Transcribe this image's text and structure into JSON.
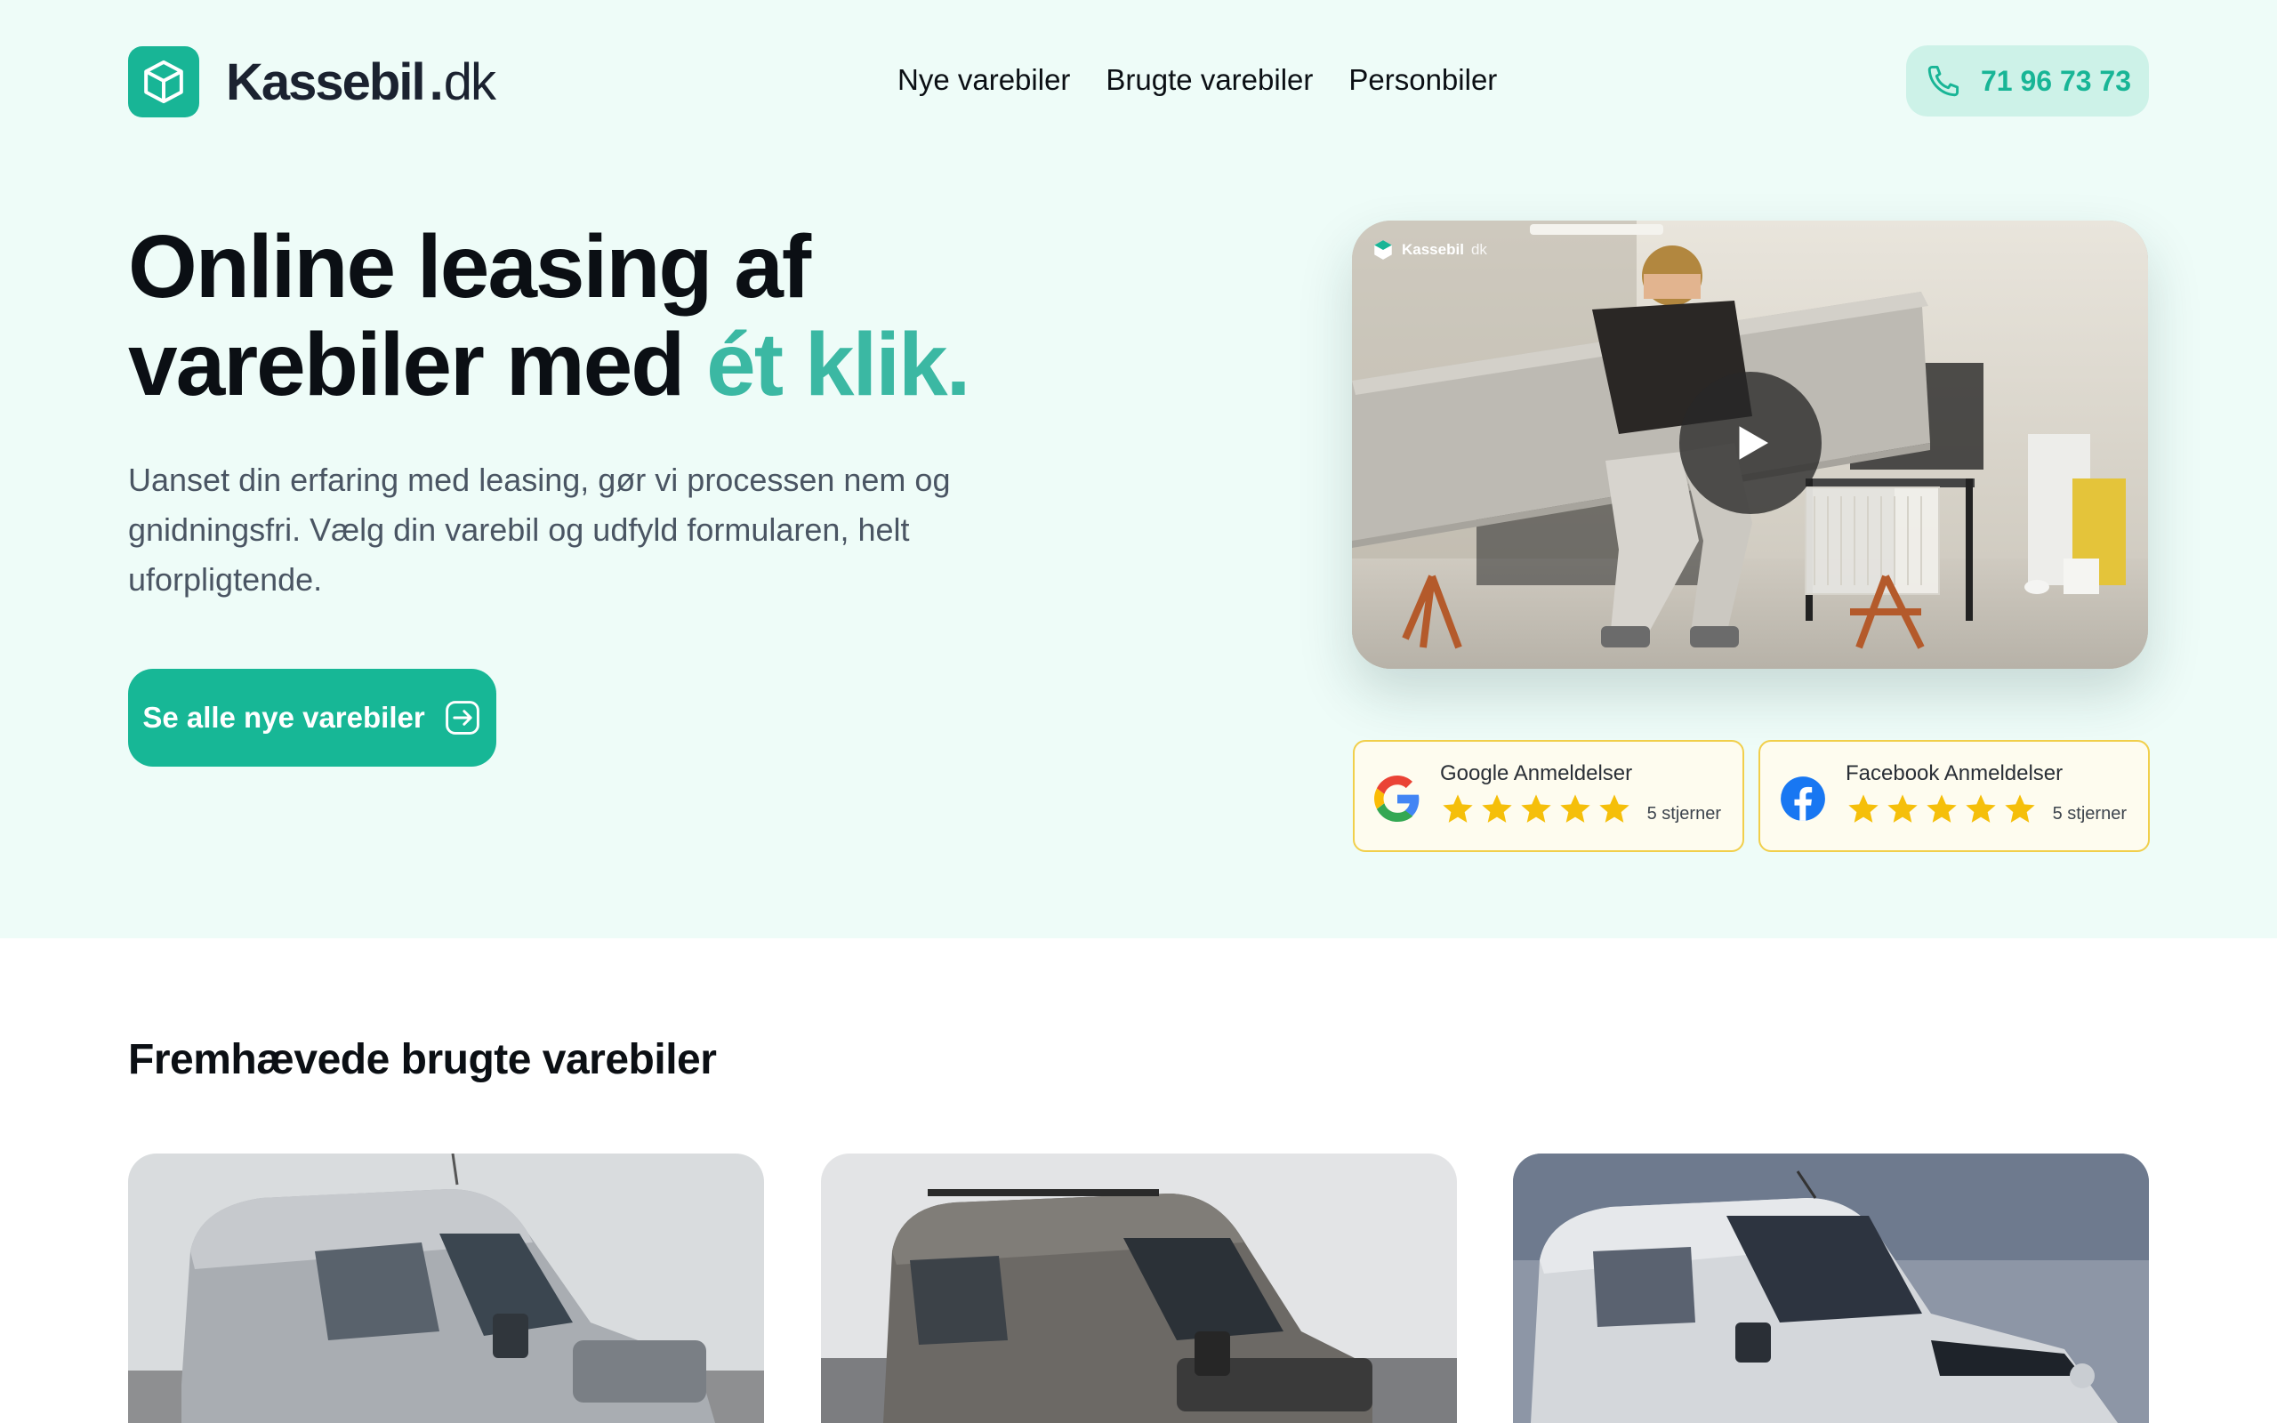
{
  "brand": {
    "name": "Kassebil",
    "dot": ".",
    "tld": "dk",
    "accent_color": "#18b596"
  },
  "nav": {
    "items": [
      {
        "label": "Nye varebiler"
      },
      {
        "label": "Brugte varebiler"
      },
      {
        "label": "Personbiler"
      }
    ]
  },
  "phone": {
    "number": "71 96 73 73",
    "icon": "phone-icon"
  },
  "hero": {
    "title_line1": "Online leasing af",
    "title_line2_prefix": "varebiler med ",
    "title_accent": "ét klik.",
    "subtitle": "Uanset din erfaring med leasing, gør vi processen nem og gnidningsfri. Vælg din varebil og udfyld formularen, helt uforpligtende.",
    "cta_label": "Se alle nye varebiler",
    "cta_icon": "arrow-right-icon"
  },
  "video": {
    "watermark_name": "Kassebil",
    "watermark_tld": "dk",
    "icon": "play-icon"
  },
  "reviews": [
    {
      "title": "Google Anmeldelser",
      "rating": 5,
      "max": 5,
      "count_label": "5 stjerner",
      "icon": "google-icon"
    },
    {
      "title": "Facebook Anmeldelser",
      "rating": 5,
      "max": 5,
      "count_label": "5 stjerner",
      "icon": "facebook-icon"
    }
  ],
  "featured": {
    "title": "Fremhævede brugte varebiler",
    "cars": [
      {
        "name": "car-image-mercedes-sprinter"
      },
      {
        "name": "car-image-ford-transit"
      },
      {
        "name": "car-image-opel-vivaro"
      }
    ]
  },
  "colors": {
    "hero_bg": "#eefcf8",
    "cta_bg": "#17b796",
    "phone_bg": "#cdf2e8",
    "star": "#f5bf0a",
    "review_border": "#f1cf4b"
  }
}
